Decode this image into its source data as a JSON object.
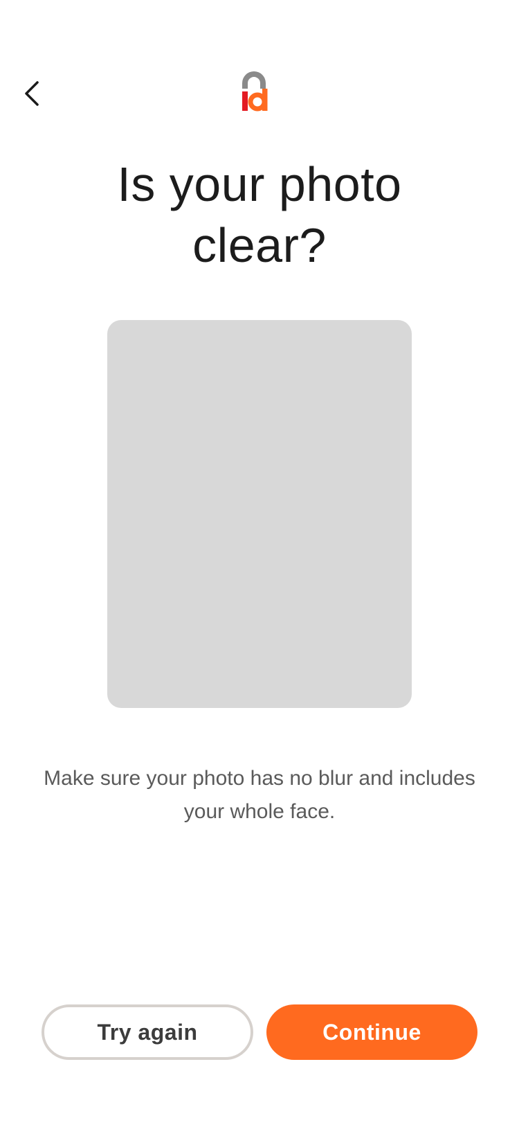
{
  "header": {
    "back_icon": "chevron-left-icon",
    "logo_text": "id",
    "logo_colors": {
      "arch": "#8a8a8a",
      "i": "#e31b23",
      "d": "#ff6a1f"
    }
  },
  "main": {
    "title": "Is your photo clear?",
    "photo_placeholder_color": "#d8d8d8",
    "hint": "Make sure your photo has no blur and includes your whole face."
  },
  "actions": {
    "try_again_label": "Try again",
    "continue_label": "Continue",
    "accent_color": "#ff6a1f"
  }
}
